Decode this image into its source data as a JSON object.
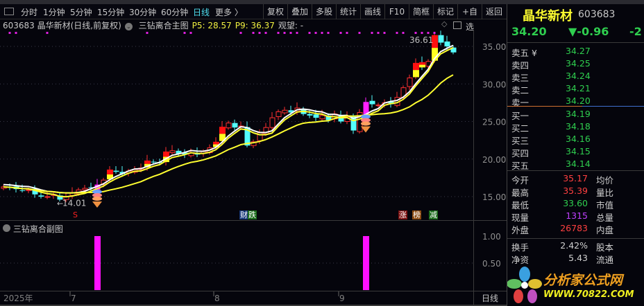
{
  "toolbar": {
    "periods": [
      "分时",
      "1分钟",
      "5分钟",
      "15分钟",
      "30分钟",
      "60分钟",
      "日线",
      "更多 〉"
    ],
    "active_period": "日线",
    "buttons": [
      "复权",
      "叠加",
      "多股",
      "统计",
      "画线",
      "F10",
      "简框",
      "标记",
      "+自选",
      "返回"
    ]
  },
  "info": {
    "title": "603683 晶华新材(日线,前复权)",
    "indicator": "三钻离合主图",
    "p5": "P5: 28.57",
    "p9": "P9: 36.37",
    "watch": "观望: -"
  },
  "sub": {
    "title": "三钻离合副图",
    "axis": [
      "1.00",
      "0.50"
    ]
  },
  "xaxis": {
    "labels": [
      "2025年",
      "7",
      "8",
      "9"
    ],
    "period_label": "日线"
  },
  "annotations": {
    "low": "14.01",
    "high": "36.61",
    "events": [
      {
        "text": "S",
        "color": "#ff2020",
        "bg": "transparent"
      },
      {
        "text": "财",
        "color": "#fff",
        "bg": "#1a3a7a"
      },
      {
        "text": "跌",
        "color": "#fff",
        "bg": "#1a6a1a"
      },
      {
        "text": "涨",
        "color": "#fff",
        "bg": "#7a1010"
      },
      {
        "text": "榜",
        "color": "#fff",
        "bg": "#8a4a10"
      },
      {
        "text": "减",
        "color": "#fff",
        "bg": "#1a6a1a"
      }
    ]
  },
  "side": {
    "name": "晶华新材",
    "code": "603683",
    "price": "34.20",
    "change": "▼-0.96",
    "pct": "-2",
    "asks": [
      {
        "label": "卖五 ¥",
        "price": "34.27"
      },
      {
        "label": "卖四",
        "price": "34.25"
      },
      {
        "label": "卖三",
        "price": "34.24"
      },
      {
        "label": "卖二",
        "price": "34.21"
      },
      {
        "label": "卖一",
        "price": "34.20"
      }
    ],
    "bids": [
      {
        "label": "买一",
        "price": "34.19"
      },
      {
        "label": "买二",
        "price": "34.18"
      },
      {
        "label": "买三",
        "price": "34.16"
      },
      {
        "label": "买四",
        "price": "34.15"
      },
      {
        "label": "买五",
        "price": "34.14"
      }
    ],
    "stats": [
      {
        "label": "今开",
        "value": "35.17",
        "right": "均价",
        "color": "red"
      },
      {
        "label": "最高",
        "value": "35.39",
        "right": "量比",
        "color": "red"
      },
      {
        "label": "最低",
        "value": "33.60",
        "right": "市值",
        "color": "green"
      },
      {
        "label": "现量",
        "value": "1315",
        "right": "总量",
        "color": "purple"
      },
      {
        "label": "外盘",
        "value": "26783",
        "right": "内盘",
        "color": "red"
      }
    ],
    "stats2": [
      {
        "label": "换手",
        "value": "2.42%",
        "right": "股本"
      },
      {
        "label": "净资",
        "value": "5.43",
        "right": "流通"
      }
    ]
  },
  "watermark": {
    "text": "分析家公式网",
    "url": "WWW.70822.COM"
  },
  "chart_data": {
    "type": "candlestick",
    "yaxis": {
      "ticks": [
        35,
        30,
        25,
        20,
        15
      ],
      "labels": [
        "35.00",
        "30.00",
        "25.00",
        "20.00",
        "15.00"
      ]
    },
    "month_start_index": {
      "7": 11,
      "8": 34,
      "9": 54
    },
    "closes": [
      16.3,
      16.2,
      16.0,
      15.8,
      15.9,
      15.3,
      15.0,
      15.0,
      15.3,
      14.6,
      15.0,
      15.5,
      15.9,
      16.1,
      16.2,
      16.6,
      17.2,
      18.6,
      18.3,
      18.0,
      18.4,
      18.6,
      18.8,
      19.8,
      19.6,
      19.5,
      21.0,
      21.1,
      20.7,
      20.6,
      20.8,
      20.6,
      21.0,
      21.5,
      22.3,
      24.3,
      24.8,
      24.2,
      24.4,
      21.8,
      22.3,
      23.5,
      24.2,
      25.5,
      26.3,
      26.5,
      26.2,
      26.8,
      26.0,
      25.8,
      25.5,
      25.8,
      25.2,
      26.0,
      25.0,
      25.6,
      23.8,
      26.2,
      27.6,
      27.3,
      27.2,
      27.5,
      27.3,
      28.2,
      29.5,
      30.8,
      32.8,
      32.2,
      33.0,
      36.5,
      35.5,
      35.0,
      34.2
    ],
    "hot_days": [
      17,
      23,
      26,
      34,
      35,
      66,
      67,
      69
    ],
    "signal_days": [
      15,
      58
    ],
    "top_dots": [
      1,
      2,
      7,
      23,
      29,
      30,
      38,
      40,
      41,
      42,
      44,
      45,
      46,
      47,
      49,
      50,
      51,
      52,
      54,
      55,
      57,
      59,
      60,
      61,
      63,
      64,
      66,
      67,
      68,
      69
    ],
    "sub_bars": {
      "indices": [
        15,
        58
      ],
      "value": 1.0
    },
    "low_index": 9,
    "high_index": 69
  }
}
